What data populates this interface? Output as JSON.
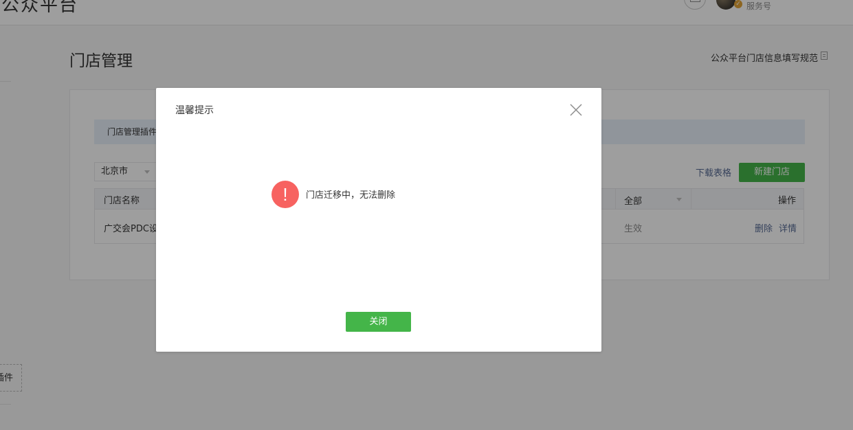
{
  "header": {
    "brand_text": "公众平台",
    "account_type": "服务号"
  },
  "page": {
    "title": "门店管理",
    "spec_link": "公众平台门店信息填写规范",
    "tip_text": "门店管理插件",
    "side_plugin_label": "插件"
  },
  "toolbar": {
    "city_selected": "北京市",
    "download_label": "下载表格",
    "new_store_label": "新建门店"
  },
  "table": {
    "columns": {
      "name": "门店名称",
      "status": "全部",
      "action": "操作"
    },
    "rows": [
      {
        "name": "广交会PDC设",
        "status": "生效",
        "delete": "删除",
        "detail": "详情"
      }
    ]
  },
  "dialog": {
    "title": "温馨提示",
    "icon_glyph": "!",
    "message": "门店迁移中，无法删除",
    "close_button": "关闭"
  },
  "colors": {
    "primary_green": "#44b549",
    "warning_red": "#f76260",
    "link_blue": "#576b95",
    "mask": "rgba(0,0,0,0.38)"
  }
}
